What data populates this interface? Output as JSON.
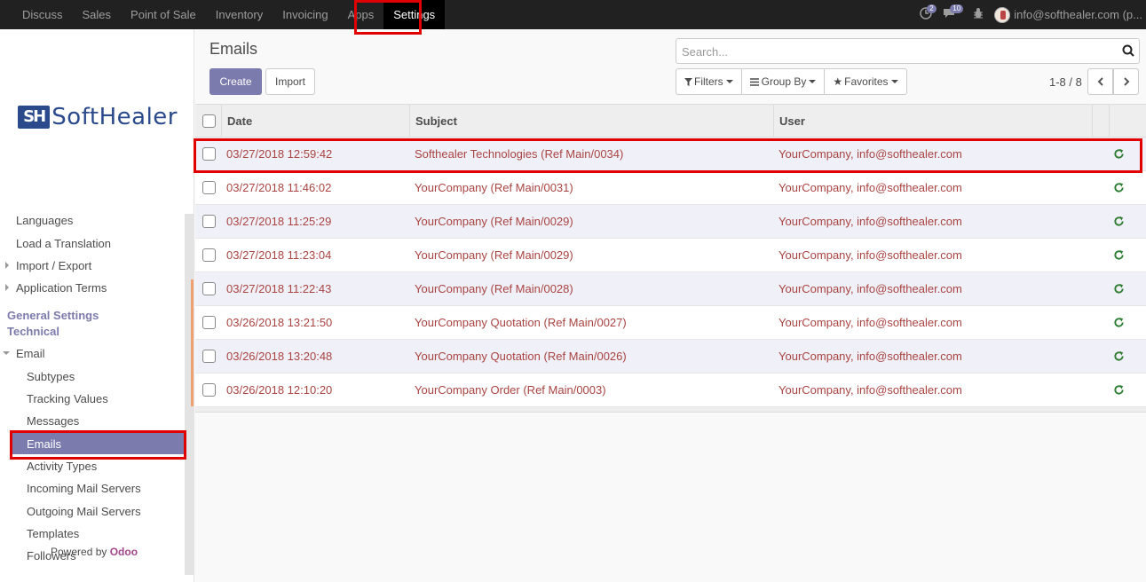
{
  "topbar": {
    "menu": [
      "Discuss",
      "Sales",
      "Point of Sale",
      "Inventory",
      "Invoicing",
      "Apps",
      "Settings"
    ],
    "active": "Settings",
    "activity_count": "2",
    "message_count": "10",
    "user": "info@softhealer.com (p..."
  },
  "sidebar": {
    "logo": {
      "mark": "SH",
      "text": "SoftHealer"
    },
    "items_top": [
      "Languages",
      "Load a Translation",
      "Import / Export",
      "Application Terms"
    ],
    "section_heads": [
      "General Settings",
      "Technical"
    ],
    "email_group": "Email",
    "email_items": [
      "Subtypes",
      "Tracking Values",
      "Messages",
      "Emails",
      "Activity Types",
      "Incoming Mail Servers",
      "Outgoing Mail Servers",
      "Templates",
      "Followers"
    ],
    "active_item": "Emails",
    "powered_by": "Powered by",
    "powered_brand": "Odoo"
  },
  "control": {
    "title": "Emails",
    "create_label": "Create",
    "import_label": "Import",
    "search_placeholder": "Search...",
    "filters_label": "Filters",
    "groupby_label": "Group By",
    "favorites_label": "Favorites",
    "pager": "1-8 / 8"
  },
  "table": {
    "headers": [
      "Date",
      "Subject",
      "User"
    ],
    "rows": [
      {
        "date": "03/27/2018 12:59:42",
        "subject": "Softhealer Technologies (Ref Main/0034)",
        "user": "YourCompany, info@softhealer.com"
      },
      {
        "date": "03/27/2018 11:46:02",
        "subject": "YourCompany (Ref Main/0031)",
        "user": "YourCompany, info@softhealer.com"
      },
      {
        "date": "03/27/2018 11:25:29",
        "subject": "YourCompany (Ref Main/0029)",
        "user": "YourCompany, info@softhealer.com"
      },
      {
        "date": "03/27/2018 11:23:04",
        "subject": "YourCompany (Ref Main/0029)",
        "user": "YourCompany, info@softhealer.com"
      },
      {
        "date": "03/27/2018 11:22:43",
        "subject": "YourCompany (Ref Main/0028)",
        "user": "YourCompany, info@softhealer.com"
      },
      {
        "date": "03/26/2018 13:21:50",
        "subject": "YourCompany Quotation (Ref Main/0027)",
        "user": "YourCompany, info@softhealer.com"
      },
      {
        "date": "03/26/2018 13:20:48",
        "subject": "YourCompany Quotation (Ref Main/0026)",
        "user": "YourCompany, info@softhealer.com"
      },
      {
        "date": "03/26/2018 12:10:20",
        "subject": "YourCompany Order (Ref Main/0003)",
        "user": "YourCompany, info@softhealer.com"
      }
    ]
  },
  "colors": {
    "brand": "#7c7bad",
    "link_red": "#a94442",
    "retry_green": "#2e7d32",
    "highlight": "#e00000"
  }
}
